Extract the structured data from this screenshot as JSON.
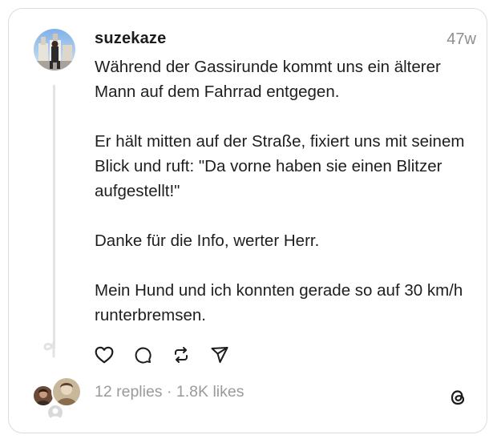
{
  "post": {
    "username": "suzekaze",
    "timestamp": "47w",
    "paragraphs": [
      "Während der Gassirunde kommt uns ein älterer Mann auf dem Fahrrad entgegen.",
      "Er hält mitten auf der Straße, fixiert uns mit seinem Blick und ruft: \"Da vorne haben sie einen Blitzer aufgestellt!\"",
      "Danke für die Info, werter Herr.",
      "Mein Hund und ich konnten gerade so auf 30 km/h runterbremsen."
    ]
  },
  "stats": {
    "replies": "12 replies",
    "separator": " · ",
    "likes": "1.8K likes"
  },
  "icons": {
    "like": "heart-icon",
    "reply": "comment-icon",
    "repost": "repost-icon",
    "share": "share-icon",
    "brand": "threads-logo-icon"
  },
  "colors": {
    "text": "#1e1e1e",
    "muted": "#8e8e8e",
    "border": "#dcdcdc",
    "thread_line": "#e3e3e3"
  }
}
